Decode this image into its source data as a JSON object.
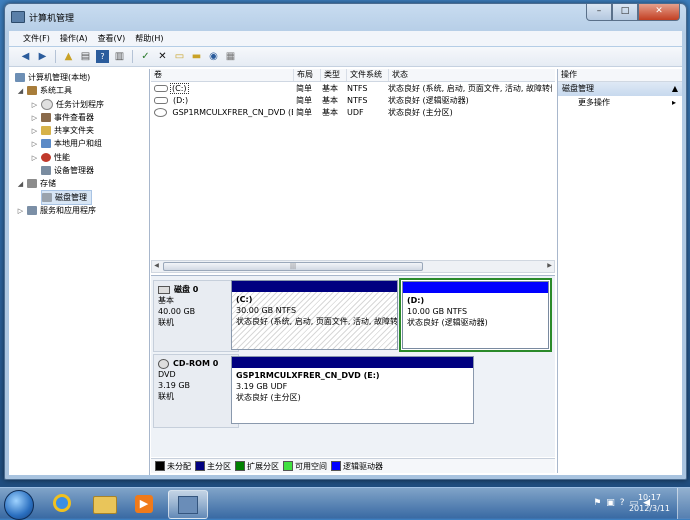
{
  "window": {
    "title": "计算机管理",
    "min": "–",
    "max": "□",
    "close": "✕"
  },
  "menu": [
    "文件(F)",
    "操作(A)",
    "查看(V)",
    "帮助(H)"
  ],
  "tree": {
    "root": "计算机管理(本地)",
    "system_tools": "系统工具",
    "task_scheduler": "任务计划程序",
    "event_viewer": "事件查看器",
    "shared_folders": "共享文件夹",
    "local_users": "本地用户和组",
    "performance": "性能",
    "device_manager": "设备管理器",
    "storage": "存储",
    "disk_management": "磁盘管理",
    "services": "服务和应用程序"
  },
  "volumes": {
    "headers": [
      "卷",
      "布局",
      "类型",
      "文件系统",
      "状态"
    ],
    "rows": [
      {
        "name": "(C:)",
        "layout": "简单",
        "type": "基本",
        "fs": "NTFS",
        "status": "状态良好 (系统, 启动, 页面文件, 活动, 故障转储"
      },
      {
        "name": "(D:)",
        "layout": "简单",
        "type": "基本",
        "fs": "NTFS",
        "status": "状态良好 (逻辑驱动器)"
      },
      {
        "name": "GSP1RMCULXFRER_CN_DVD (E:)",
        "layout": "简单",
        "type": "基本",
        "fs": "UDF",
        "status": "状态良好 (主分区)"
      }
    ],
    "scroll_grip": "|||"
  },
  "disks": {
    "disk0": {
      "name": "磁盘 0",
      "type": "基本",
      "size": "40.00 GB",
      "state": "联机"
    },
    "c": {
      "label": "(C:)",
      "size": "30.00 GB NTFS",
      "status": "状态良好 (系统, 启动, 页面文件, 活动, 故障转"
    },
    "d": {
      "label": "(D:)",
      "size": "10.00 GB NTFS",
      "status": "状态良好 (逻辑驱动器)"
    },
    "cdrom0": {
      "name": "CD-ROM 0",
      "type": "DVD",
      "size": "3.19 GB",
      "state": "联机"
    },
    "e": {
      "label": "GSP1RMCULXFRER_CN_DVD  (E:)",
      "size": "3.19 GB UDF",
      "status": "状态良好 (主分区)"
    }
  },
  "legend": [
    {
      "label": "未分配",
      "color": "#000000"
    },
    {
      "label": "主分区",
      "color": "#000080"
    },
    {
      "label": "扩展分区",
      "color": "#008000"
    },
    {
      "label": "可用空间",
      "color": "#40e040"
    },
    {
      "label": "逻辑驱动器",
      "color": "#0000ff"
    }
  ],
  "actions": {
    "header": "操作",
    "section": "磁盘管理",
    "more": "更多操作"
  },
  "taskbar": {
    "time": "10:17",
    "date": "2012/3/11"
  },
  "colors": {
    "primary": "#000080",
    "logical": "#0000ff",
    "extended": "#008000"
  }
}
